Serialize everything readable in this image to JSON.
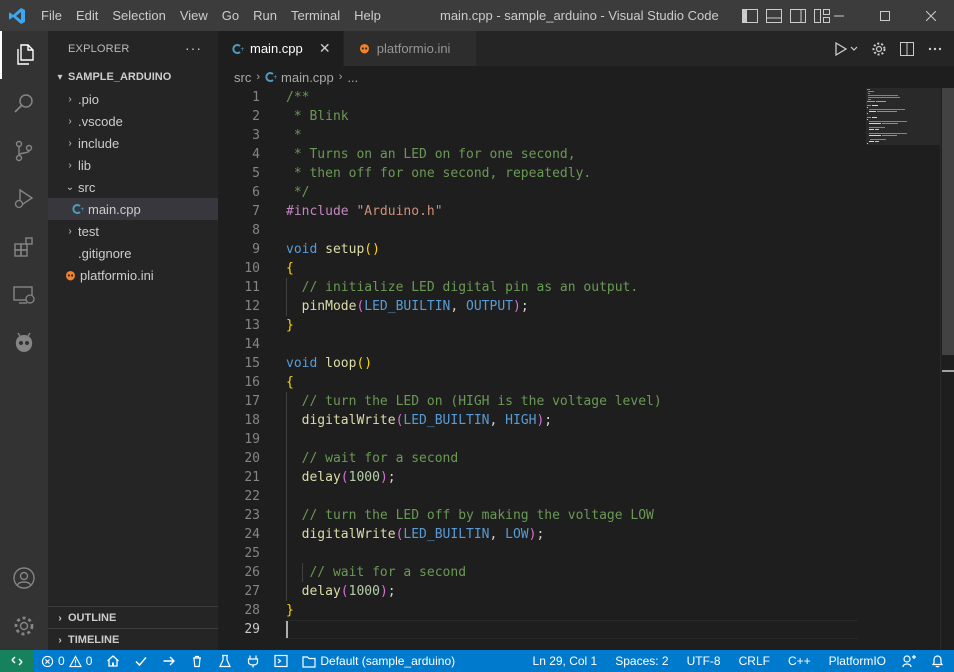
{
  "titlebar": {
    "menu": [
      "File",
      "Edit",
      "Selection",
      "View",
      "Go",
      "Run",
      "Terminal",
      "Help"
    ],
    "title": "main.cpp - sample_arduino - Visual Studio Code"
  },
  "explorer": {
    "header": "EXPLORER",
    "more": "···",
    "project": "SAMPLE_ARDUINO",
    "items": [
      {
        "label": ".pio",
        "kind": "folder"
      },
      {
        "label": ".vscode",
        "kind": "folder"
      },
      {
        "label": "include",
        "kind": "folder"
      },
      {
        "label": "lib",
        "kind": "folder"
      },
      {
        "label": "src",
        "kind": "folder-open"
      },
      {
        "label": "main.cpp",
        "kind": "cpp-file"
      },
      {
        "label": "test",
        "kind": "folder"
      },
      {
        "label": ".gitignore",
        "kind": "file"
      },
      {
        "label": "platformio.ini",
        "kind": "pio-file"
      }
    ],
    "outline": "OUTLINE",
    "timeline": "TIMELINE"
  },
  "tabs": [
    {
      "label": "main.cpp",
      "close": "✕"
    },
    {
      "label": "platformio.ini"
    }
  ],
  "breadcrumb": {
    "folder": "src",
    "file": "main.cpp",
    "symbol": "..."
  },
  "editor": {
    "line_numbers": [
      "1",
      "2",
      "3",
      "4",
      "5",
      "6",
      "7",
      "8",
      "9",
      "10",
      "11",
      "12",
      "13",
      "14",
      "15",
      "16",
      "17",
      "18",
      "19",
      "20",
      "21",
      "22",
      "23",
      "24",
      "25",
      "26",
      "27",
      "28",
      "29"
    ],
    "current_line": 29
  },
  "statusbar": {
    "errors": "0",
    "warnings": "0",
    "env": "Default (sample_arduino)",
    "position": "Ln 29, Col 1",
    "spaces": "Spaces: 2",
    "encoding": "UTF-8",
    "eol": "CRLF",
    "language": "C++",
    "platformio": "PlatformIO"
  },
  "colors": {
    "accent": "#007acc",
    "remote": "#16825d",
    "comment": "#6a9955",
    "keyword": "#569cd6",
    "function": "#dcdcaa",
    "constant": "#4fc1ff",
    "string": "#ce9178",
    "number": "#b5cea8",
    "preprocessor": "#c586c0"
  }
}
